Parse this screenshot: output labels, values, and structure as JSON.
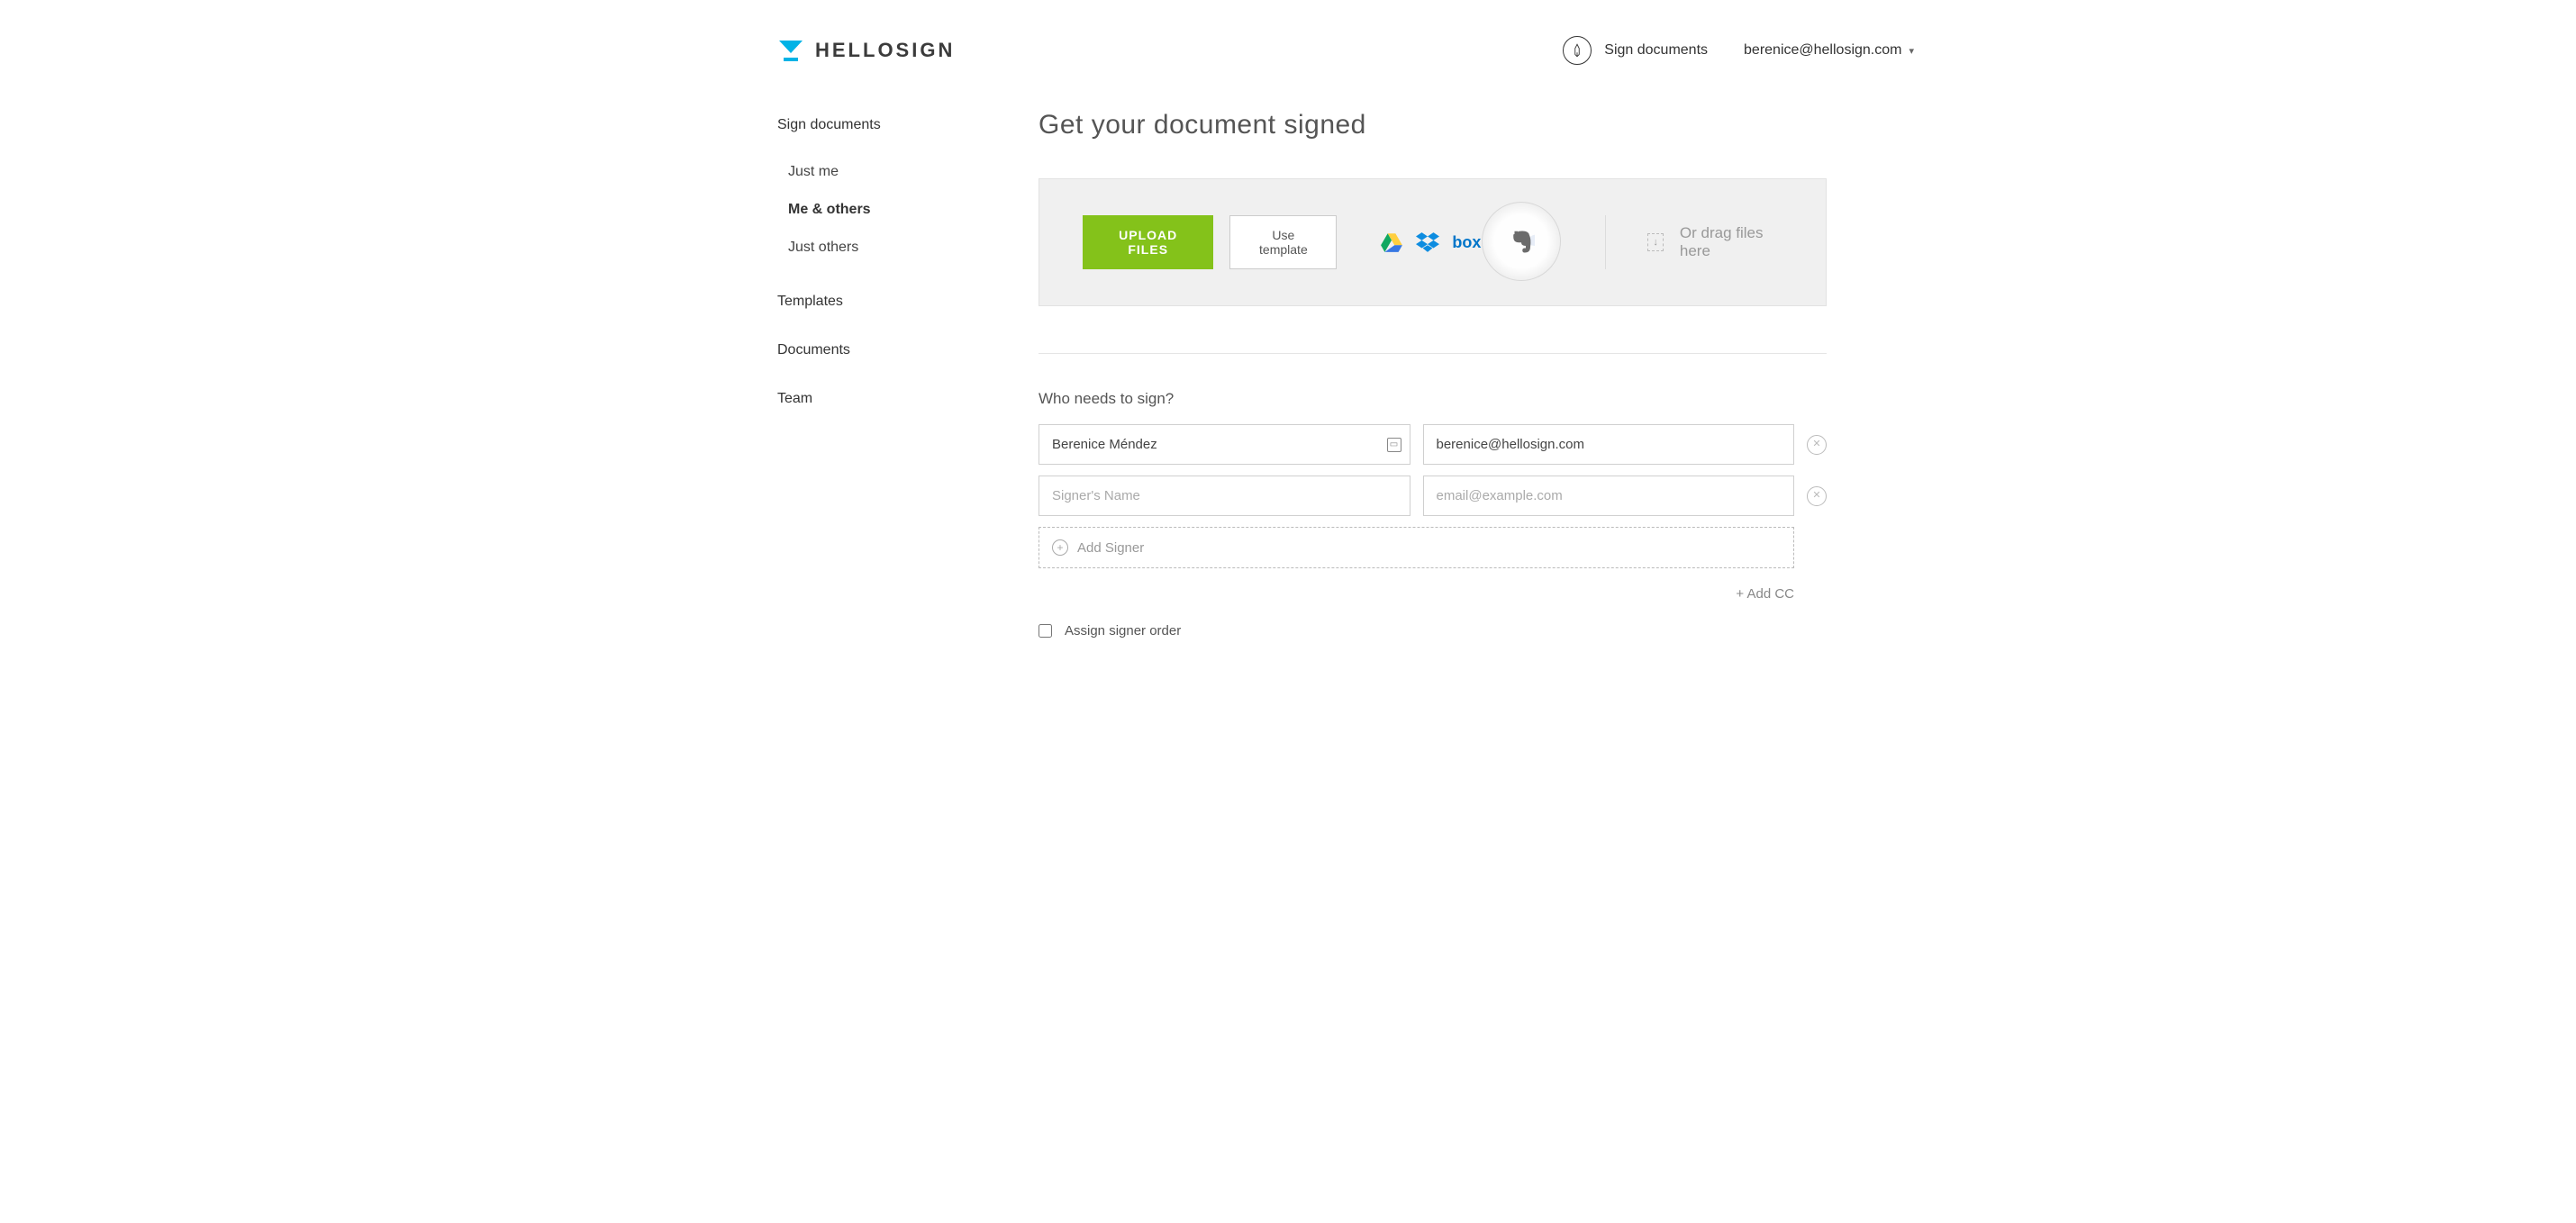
{
  "header": {
    "brand": "HELLOSIGN",
    "sign_link": "Sign documents",
    "user_email": "berenice@hellosign.com"
  },
  "sidebar": {
    "sign_documents": "Sign documents",
    "items": [
      {
        "label": "Just me",
        "active": false
      },
      {
        "label": "Me & others",
        "active": true
      },
      {
        "label": "Just others",
        "active": false
      }
    ],
    "templates": "Templates",
    "documents": "Documents",
    "team": "Team"
  },
  "main": {
    "title": "Get your document signed",
    "upload_btn": "UPLOAD FILES",
    "template_btn": "Use template",
    "drag_text": "Or drag files here",
    "who_sign_label": "Who needs to sign?",
    "signers": [
      {
        "name": "Berenice Méndez",
        "email": "berenice@hellosign.com"
      },
      {
        "name": "",
        "email": ""
      }
    ],
    "name_placeholder": "Signer's Name",
    "email_placeholder": "email@example.com",
    "add_signer": "Add Signer",
    "add_cc": "+ Add CC",
    "assign_order": "Assign signer order"
  },
  "icons": {
    "gdrive": "google-drive-icon",
    "dropbox": "dropbox-icon",
    "box": "box-icon",
    "evernote": "evernote-icon",
    "onedrive": "onedrive-icon"
  },
  "colors": {
    "brand_blue": "#00b3e6",
    "upload_green": "#84c21a"
  }
}
